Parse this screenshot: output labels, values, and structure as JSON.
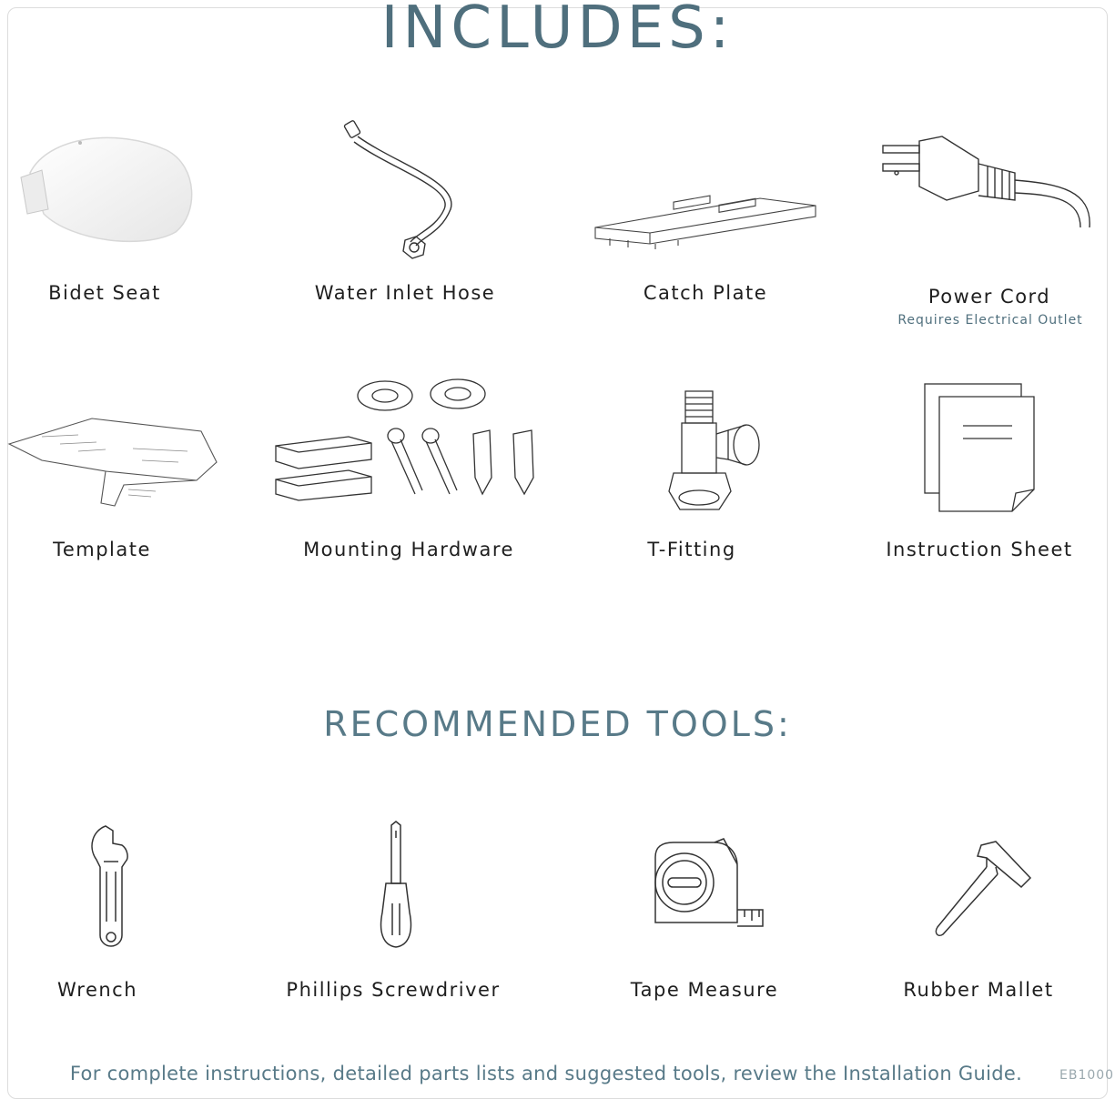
{
  "includes_title": "INCLUDES:",
  "includes": [
    {
      "label": "Bidet Seat",
      "icon": "bidet-seat-icon"
    },
    {
      "label": "Water Inlet Hose",
      "icon": "hose-icon"
    },
    {
      "label": "Catch Plate",
      "icon": "catch-plate-icon"
    },
    {
      "label": "Power Cord",
      "sublabel": "Requires Electrical Outlet",
      "icon": "power-cord-icon"
    },
    {
      "label": "Template",
      "icon": "template-icon"
    },
    {
      "label": "Mounting Hardware",
      "icon": "mounting-hardware-icon"
    },
    {
      "label": "T-Fitting",
      "icon": "t-fitting-icon"
    },
    {
      "label": "Instruction Sheet",
      "icon": "instruction-sheet-icon"
    }
  ],
  "tools_title": "RECOMMENDED TOOLS:",
  "tools": [
    {
      "label": "Wrench",
      "icon": "wrench-icon"
    },
    {
      "label": "Phillips Screwdriver",
      "icon": "screwdriver-icon"
    },
    {
      "label": "Tape Measure",
      "icon": "tape-measure-icon"
    },
    {
      "label": "Rubber Mallet",
      "icon": "mallet-icon"
    }
  ],
  "footer_text": "For complete instructions, detailed parts lists and suggested tools, review the Installation Guide.",
  "code": "EB1000",
  "colors": {
    "accent": "#4f6f7d",
    "text": "#1e1e1e",
    "line": "#3a3a3a"
  }
}
